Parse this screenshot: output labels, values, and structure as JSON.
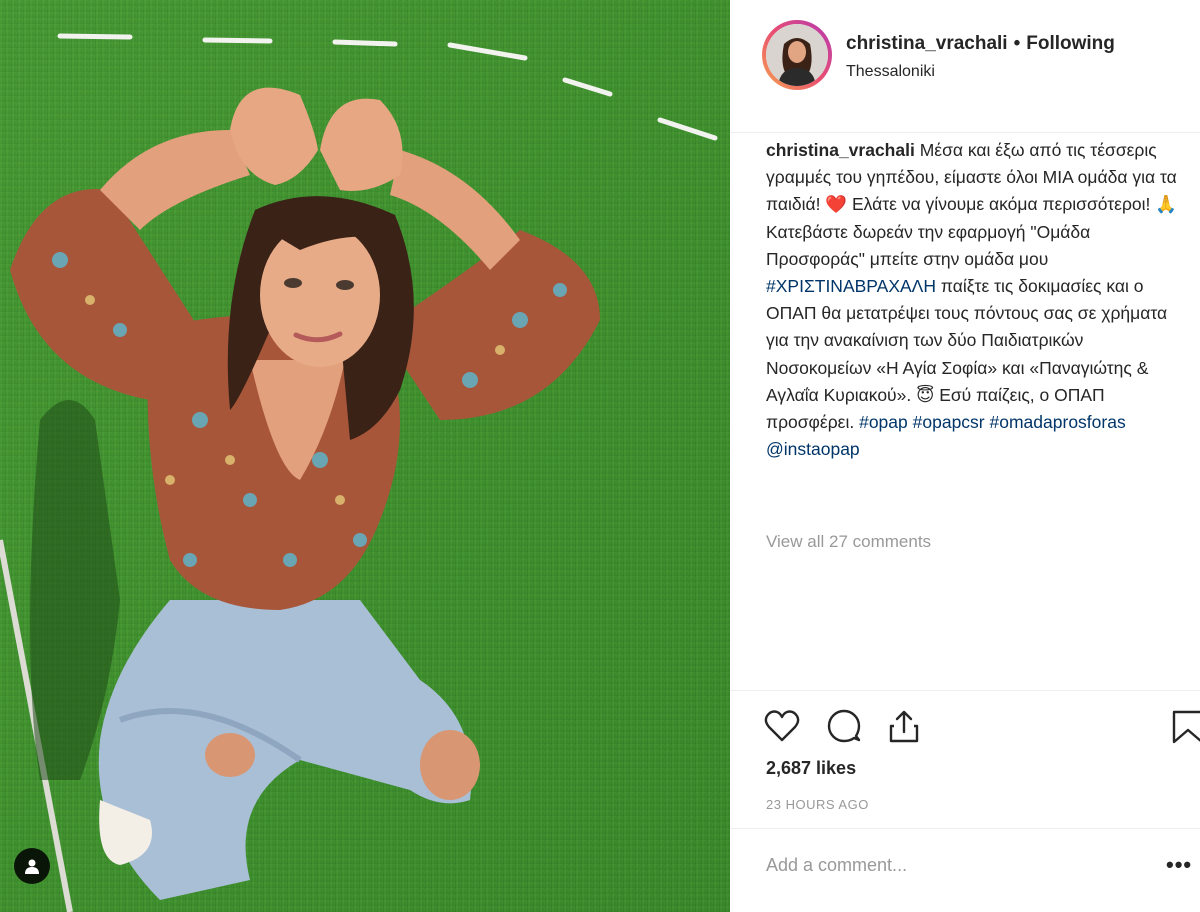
{
  "post": {
    "username": "christina_vrachali",
    "separator": "•",
    "follow_status": "Following",
    "location": "Thessaloniki",
    "caption": {
      "username": "christina_vrachali",
      "part1": " Μέσα και έξω από τις τέσσερις γραμμές του γηπέδου, είμαστε όλοι ΜΙΑ ομάδα για τα παιδιά! ",
      "heart_emoji": "❤️",
      "part2": " Ελάτε να γίνουμε ακόμα περισσότεροι! ",
      "pray_emoji": "🙏",
      "part3": " Κατεβάστε δωρεάν την εφαρμογή \"Ομάδα Προσφοράς\" μπείτε στην ομάδα μου ",
      "tag1": "#ΧΡΙΣΤΙΝΑΒΡΑΧΑΛΗ",
      "part4": " παίξτε τις δοκιμασίες και ο ΟΠΑΠ θα μετατρέψει τους πόντους σας σε χρήματα για την ανακαίνιση των δύο Παιδιατρικών Νοσοκομείων «Η Αγία Σοφία» και «Παναγιώτης & Αγλαΐα Κυριακού». ",
      "smile_emoji": "😇",
      "part5": " Εσύ παίζεις, ο ΟΠΑΠ προσφέρει. ",
      "tag2": "#opap",
      "tag3": "#opapcsr",
      "tag4": "#omadaprosforas",
      "mention": "@instaopap"
    },
    "view_all_comments": "View all 27 comments",
    "likes": "2,687 likes",
    "time_ago": "23 HOURS AGO",
    "add_comment_placeholder": "Add a comment...",
    "more_options": "•••"
  },
  "icons": {
    "like": "heart-icon",
    "comment": "comment-icon",
    "share": "share-icon",
    "save": "bookmark-icon",
    "tagged": "user-tag-icon"
  },
  "colors": {
    "text": "#262626",
    "muted": "#999999",
    "link": "#003569",
    "grass": "#3d8b2f"
  }
}
